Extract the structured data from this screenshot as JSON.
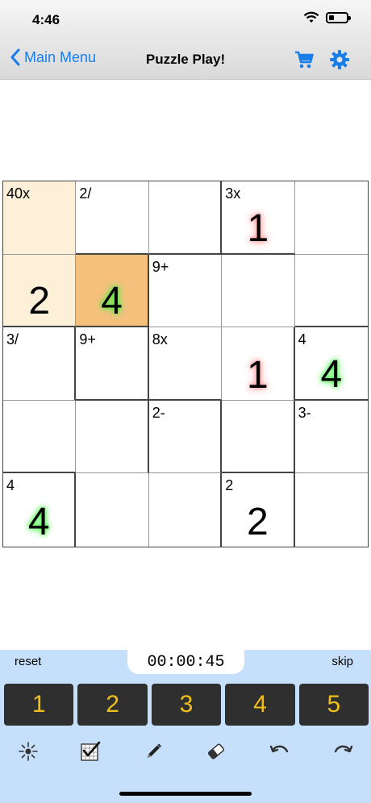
{
  "status": {
    "time": "4:46"
  },
  "nav": {
    "back_label": "Main Menu",
    "title": "Puzzle Play!"
  },
  "grid": {
    "cells": [
      {
        "label": "40x",
        "value": ""
      },
      {
        "label": "2/",
        "value": ""
      },
      {
        "label": "",
        "value": ""
      },
      {
        "label": "3x",
        "value": "1"
      },
      {
        "label": "",
        "value": ""
      },
      {
        "label": "",
        "value": "2"
      },
      {
        "label": "",
        "value": "4"
      },
      {
        "label": "9+",
        "value": ""
      },
      {
        "label": "",
        "value": ""
      },
      {
        "label": "",
        "value": ""
      },
      {
        "label": "3/",
        "value": ""
      },
      {
        "label": "9+",
        "value": ""
      },
      {
        "label": "8x",
        "value": ""
      },
      {
        "label": "",
        "value": "1"
      },
      {
        "label": "4",
        "value": "4"
      },
      {
        "label": "",
        "value": ""
      },
      {
        "label": "",
        "value": ""
      },
      {
        "label": "2-",
        "value": ""
      },
      {
        "label": "",
        "value": ""
      },
      {
        "label": "3-",
        "value": ""
      },
      {
        "label": "4",
        "value": "4"
      },
      {
        "label": "",
        "value": ""
      },
      {
        "label": "",
        "value": ""
      },
      {
        "label": "2",
        "value": "2"
      },
      {
        "label": "",
        "value": ""
      }
    ]
  },
  "controls": {
    "reset_label": "reset",
    "skip_label": "skip",
    "timer": "00:00:45"
  },
  "numpad": [
    "1",
    "2",
    "3",
    "4",
    "5"
  ],
  "colors": {
    "accent": "#1a7ee8",
    "panel": "#c6dffb",
    "digit": "#f0c01a",
    "selected_cell": "#f5c07c",
    "cage_highlight": "#fdf0d9"
  },
  "icons": [
    "chevron-left-icon",
    "cart-icon",
    "gear-icon",
    "reveal-icon",
    "check-grid-icon",
    "pencil-icon",
    "eraser-icon",
    "undo-icon",
    "redo-icon"
  ]
}
